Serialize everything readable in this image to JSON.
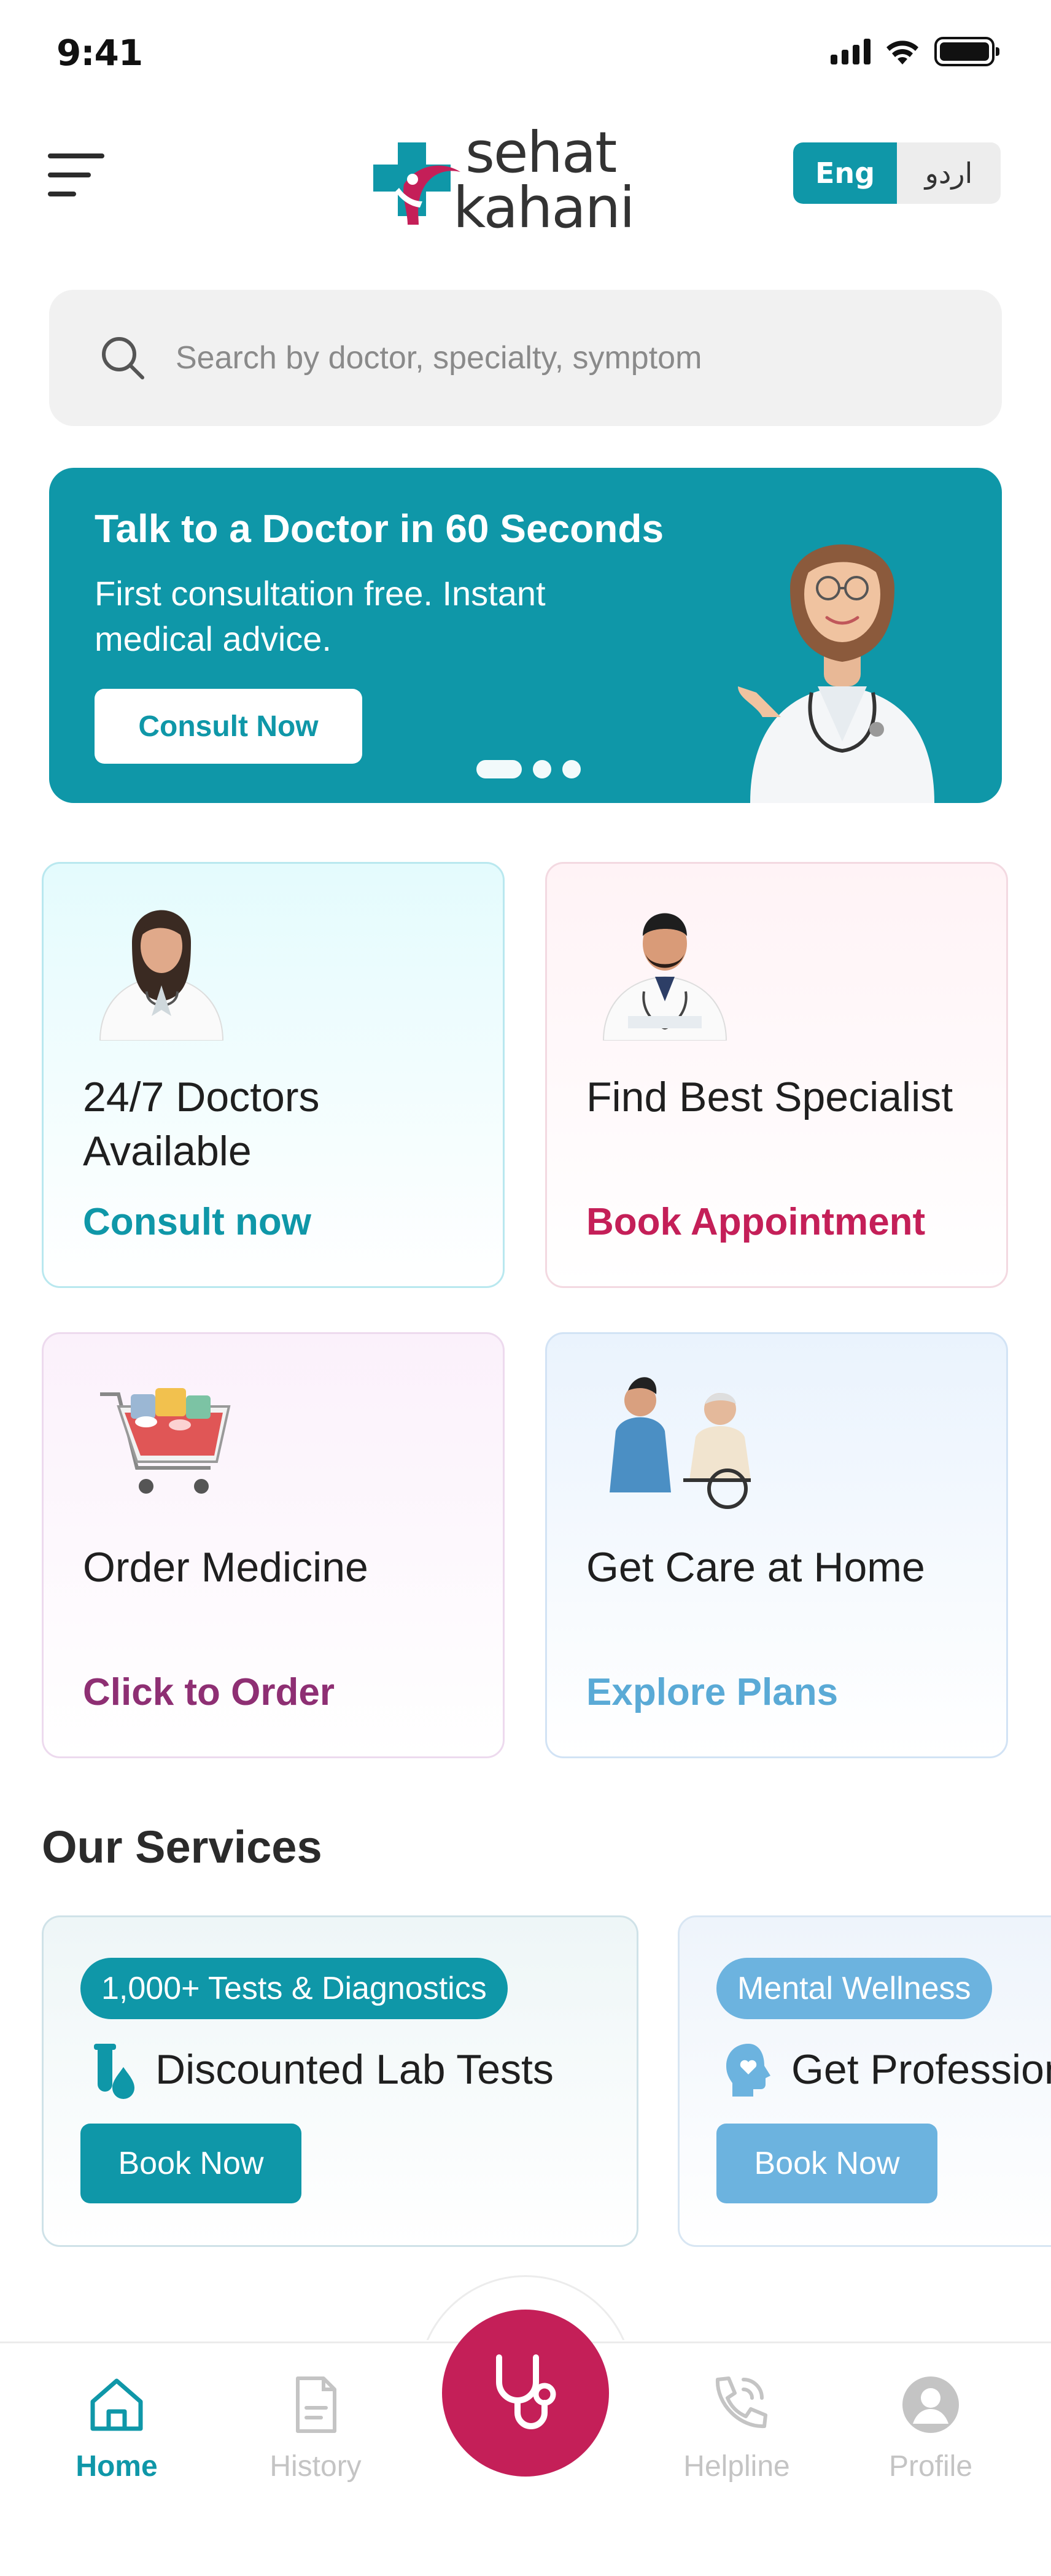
{
  "status_bar": {
    "time": "9:41"
  },
  "header": {
    "logo_text": "sehat kahani",
    "lang_options": [
      "Eng",
      "اردو"
    ],
    "active_lang": "Eng"
  },
  "search": {
    "placeholder": "Search by doctor, specialty, symptom"
  },
  "banner": {
    "title": "Talk to a Doctor in 60 Seconds",
    "subtitle": "First consultation free. Instant medical advice.",
    "button": "Consult Now",
    "slide_count": 3,
    "active_slide": 1
  },
  "cards": [
    {
      "title": "24/7 Doctors Available",
      "action": "Consult now",
      "action_color": "#0f97a8",
      "icon": "female-doctor-image"
    },
    {
      "title": "Find Best Specialist",
      "action": "Book Appointment",
      "action_color": "#c41f58",
      "icon": "male-doctor-image"
    },
    {
      "title": "Order Medicine",
      "action": "Click to Order",
      "action_color": "#8e2f73",
      "icon": "medicine-cart-image"
    },
    {
      "title": "Get Care at Home",
      "action": "Explore Plans",
      "action_color": "#5aaad6",
      "icon": "home-care-image"
    }
  ],
  "services": {
    "title": "Our Services",
    "items": [
      {
        "tag": "1,000+ Tests & Diagnostics",
        "title": "Discounted Lab Tests",
        "button": "Book Now",
        "color": "#0f97a8",
        "icon": "test-tube-icon"
      },
      {
        "tag": "Mental Wellness",
        "title": "Get Professional Help",
        "button": "Book Now",
        "color": "#6cb3df",
        "icon": "mind-heart-icon"
      }
    ]
  },
  "bottom_nav": {
    "items": [
      {
        "label": "Home",
        "icon": "home-icon",
        "active": true
      },
      {
        "label": "History",
        "icon": "history-icon",
        "active": false
      },
      {
        "label": "Helpline",
        "icon": "phone-icon",
        "active": false
      },
      {
        "label": "Profile",
        "icon": "profile-icon",
        "active": false
      }
    ],
    "center_icon": "stethoscope-icon"
  },
  "colors": {
    "primary": "#0f97a8",
    "accent": "#c41f58"
  }
}
